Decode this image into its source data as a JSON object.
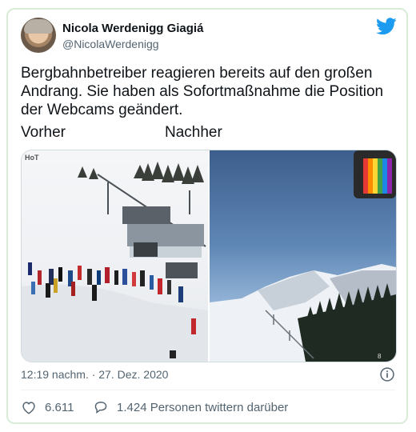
{
  "author": {
    "name": "Nicola Werdenigg Giagiá",
    "handle": "@NicolaWerdenigg"
  },
  "tweet": {
    "text": "Bergbahnbetreiber reagieren bereits auf den großen Andrang. Sie haben als Sofortmaßnahme die Position der Webcams geändert.",
    "label_before": "Vorher",
    "label_after": "Nachher"
  },
  "media": {
    "left_watermark": "HoT",
    "left_icon": "ski-slope-crowd-photo",
    "right_icon": "mountain-sky-webcam-photo"
  },
  "meta": {
    "timestamp": "12:19 nachm. · 27. Dez. 2020"
  },
  "stats": {
    "likes": "6.611",
    "people_tweeting": "1.424 Personen twittern darüber"
  },
  "colors": {
    "twitter_blue": "#1d9bf0",
    "secondary_text": "#536471",
    "frame_border": "#d8ecd8"
  }
}
